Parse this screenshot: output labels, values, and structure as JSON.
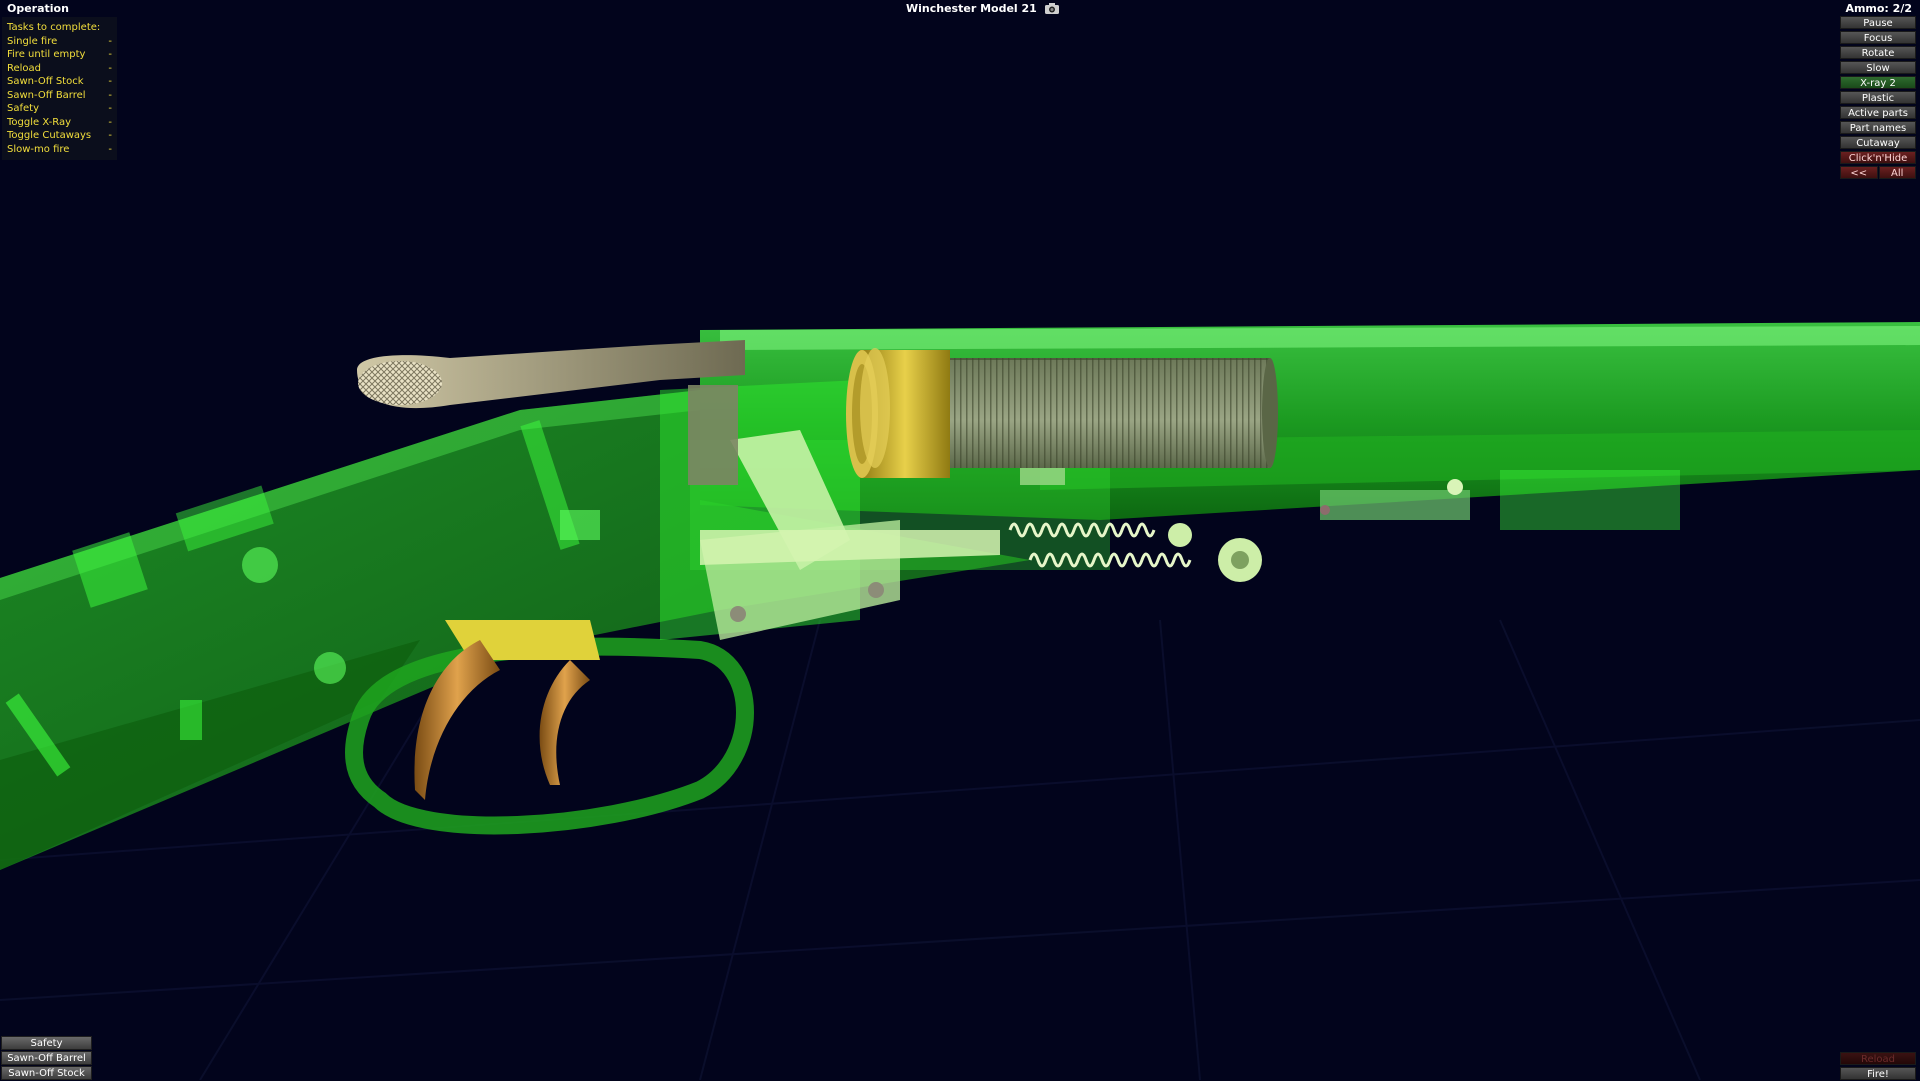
{
  "app": {
    "section_title": "Operation",
    "model_title": "Winchester Model 21",
    "ammo": "Ammo: 2/2"
  },
  "tasks": {
    "header": "Tasks to complete:",
    "items": [
      {
        "label": "Single fire",
        "status": "-"
      },
      {
        "label": "Fire until empty",
        "status": "-"
      },
      {
        "label": "Reload",
        "status": "-"
      },
      {
        "label": "Sawn-Off Stock",
        "status": "-"
      },
      {
        "label": "Sawn-Off Barrel",
        "status": "-"
      },
      {
        "label": "Safety",
        "status": "-"
      },
      {
        "label": "Toggle X-Ray",
        "status": "-"
      },
      {
        "label": "Toggle Cutaways",
        "status": "-"
      },
      {
        "label": "Slow-mo fire",
        "status": "-"
      }
    ]
  },
  "controls": {
    "pause": "Pause",
    "focus": "Focus",
    "rotate": "Rotate",
    "slow": "Slow",
    "xray": "X-ray 2",
    "plastic": "Plastic",
    "active_parts": "Active parts",
    "part_names": "Part names",
    "cutaway": "Cutaway",
    "click_hide": "Click'n'Hide",
    "prev": "<<",
    "all": "All"
  },
  "bottom_left": {
    "safety": "Safety",
    "sawn_barrel": "Sawn-Off Barrel",
    "sawn_stock": "Sawn-Off Stock"
  },
  "bottom_right": {
    "reload": "Reload",
    "fire": "Fire!"
  },
  "colors": {
    "background": "#02041c",
    "xray_green": "#2fe02f",
    "task_yellow": "#f3df3c",
    "brass": "#c9b22c"
  }
}
